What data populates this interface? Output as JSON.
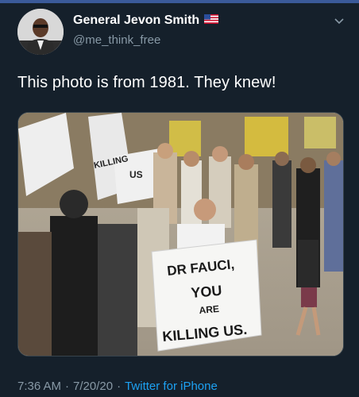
{
  "tweet": {
    "display_name": "General Jevon Smith",
    "flag_icon": "us-flag-icon",
    "handle": "@me_think_free",
    "text": "This photo is from 1981. They knew!",
    "photo": {
      "sign_main_lines": [
        "DR FAUCI,",
        "YOU",
        "ARE",
        "KILLING US."
      ],
      "sign_left_lines": [
        "KILLING",
        "US"
      ]
    },
    "time": "7:36 AM",
    "separator": "·",
    "date": "7/20/20",
    "source": "Twitter for iPhone"
  },
  "colors": {
    "background": "#15202b",
    "primary_text": "#ffffff",
    "secondary_text": "#8899a6",
    "link": "#1da1f2"
  }
}
